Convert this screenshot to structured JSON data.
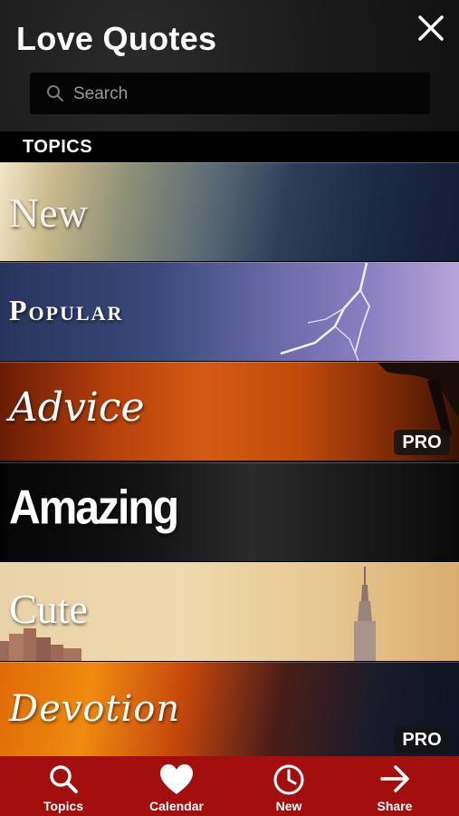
{
  "header": {
    "title": "Love Quotes",
    "close_icon": "close-icon",
    "search": {
      "placeholder": "Search",
      "value": ""
    }
  },
  "section": {
    "label": "TOPICS"
  },
  "topics": [
    {
      "label": "New",
      "pro": ""
    },
    {
      "label": "Popular",
      "pro": ""
    },
    {
      "label": "Advice",
      "pro": "PRO"
    },
    {
      "label": "Amazing",
      "pro": ""
    },
    {
      "label": "Cute",
      "pro": ""
    },
    {
      "label": "Devotion",
      "pro": "PRO"
    }
  ],
  "tabbar": {
    "items": [
      {
        "label": "Topics",
        "icon": "search-icon"
      },
      {
        "label": "Calendar",
        "icon": "heart-icon"
      },
      {
        "label": "New",
        "icon": "clock-icon"
      },
      {
        "label": "Share",
        "icon": "arrow-right-icon"
      }
    ]
  },
  "colors": {
    "tabbar_bg": "#a30f0f",
    "header_bg": "#1a1a1a",
    "text": "#ffffff"
  }
}
